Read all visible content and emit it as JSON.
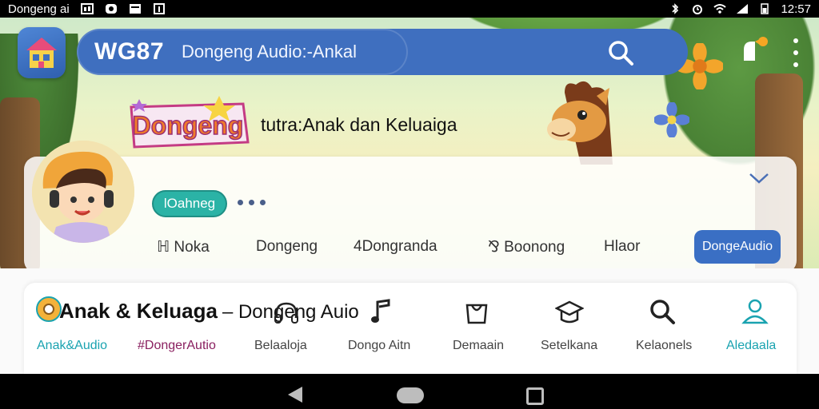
{
  "status_bar": {
    "app_name": "Dongeng ai",
    "time": "12:57"
  },
  "app_bar": {
    "brand": "WG87",
    "subtitle": "Dongeng Audio:-Ankal"
  },
  "banner": {
    "logo_text": "Dongeng",
    "tagline": "tutra:Anak dan Keluaiga"
  },
  "profile": {
    "chip_label": "lOahneg",
    "categories": [
      {
        "label": "ℍ Noka"
      },
      {
        "label": "Dongeng"
      },
      {
        "label": "4Dongranda"
      },
      {
        "label": "⅋ Boonong"
      },
      {
        "label": "Hlaor"
      }
    ],
    "action_button": "DongeAudio"
  },
  "bottom_nav": {
    "heading_bold": "Anak & Keluaga",
    "heading_rest": "– Dongeng Auio",
    "items": [
      {
        "label": "Anak&Audio",
        "color": "#1aa3b0",
        "icon": "cd-icon"
      },
      {
        "label": "#DongerAutio",
        "color": "#8a2060",
        "icon": "none"
      },
      {
        "label": "Belaaloja",
        "color": "#444444",
        "icon": "headphones-icon"
      },
      {
        "label": "Dongo Aitn",
        "color": "#444444",
        "icon": "music-note-icon"
      },
      {
        "label": "Demaain",
        "color": "#444444",
        "icon": "bag-icon"
      },
      {
        "label": "Setelkana",
        "color": "#444444",
        "icon": "graduation-cap-icon"
      },
      {
        "label": "Kelaonels",
        "color": "#444444",
        "icon": "search-icon"
      },
      {
        "label": "Aledaala",
        "color": "#1aa3b0",
        "icon": "person-icon"
      }
    ]
  },
  "colors": {
    "app_bar": "#3f6fbf",
    "accent_teal": "#2bb3a6",
    "action_blue": "#3a6fc4"
  }
}
